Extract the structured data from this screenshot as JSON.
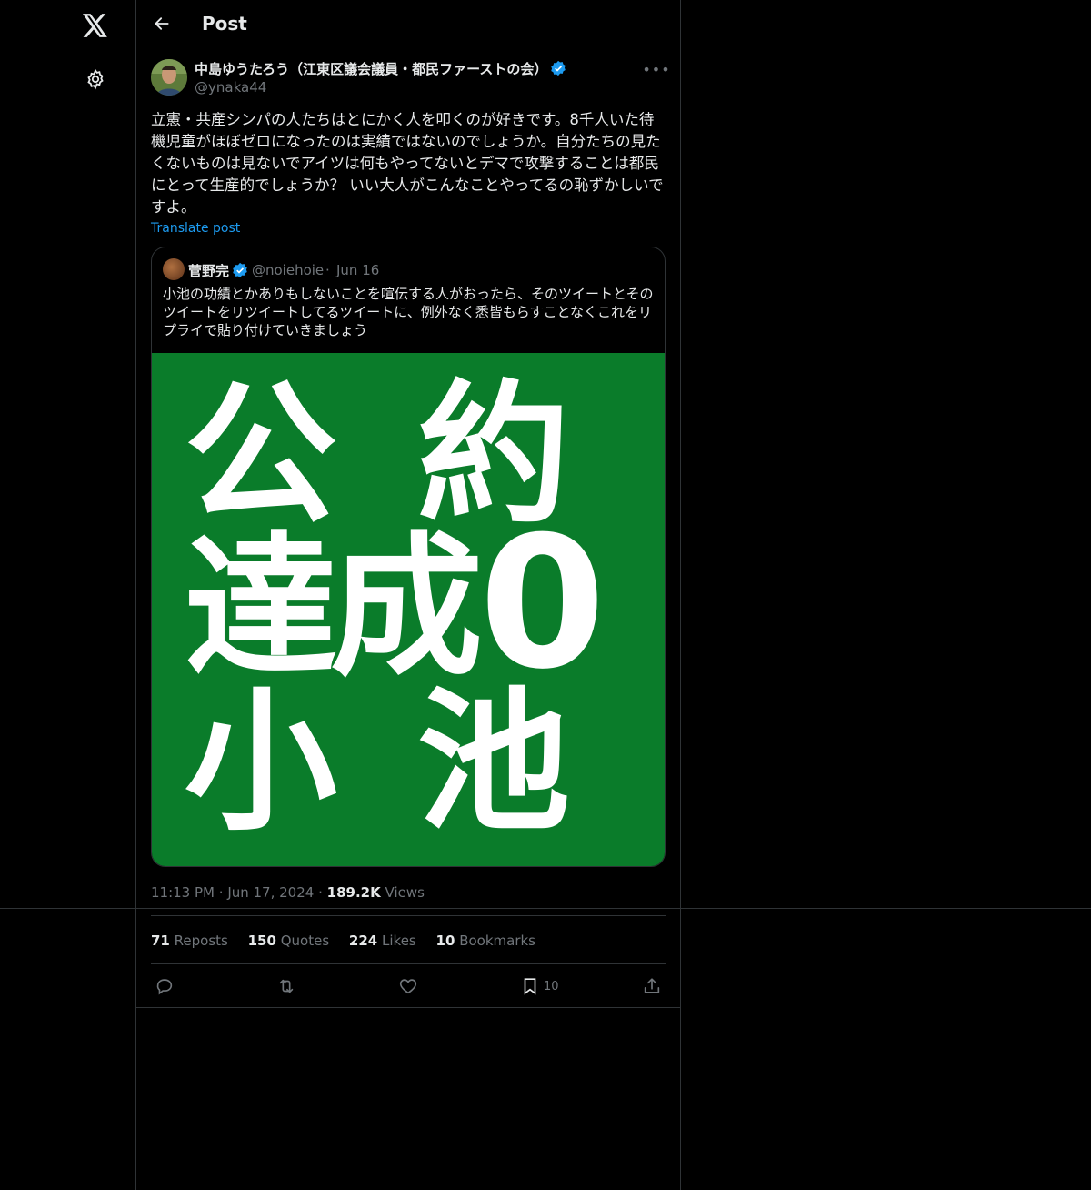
{
  "nav": {
    "logo": "x-logo-icon",
    "settings": "gear-icon"
  },
  "header": {
    "title": "Post"
  },
  "post": {
    "author_name": "中島ゆうたろう（江東区議会議員・都民ファーストの会）",
    "handle": "@ynaka44",
    "text": "立憲・共産シンパの人たちはとにかく人を叩くのが好きです。8千人いた待機児童がほぼゼロになったのは実績ではないのでしょうか。自分たちの見たくないものは見ないでアイツは何もやってないとデマで攻撃することは都民にとって生産的でしょうか？ いい大人がこんなことやってるの恥ずかしいですよ。",
    "translate": "Translate post",
    "time": "11:13 PM",
    "date": "Jun 17, 2024",
    "views_count": "189.2K",
    "views_label": "Views",
    "reposts": {
      "count": "71",
      "label": "Reposts"
    },
    "quotes": {
      "count": "150",
      "label": "Quotes"
    },
    "likes": {
      "count": "224",
      "label": "Likes"
    },
    "bookmarks": {
      "count": "10",
      "label": "Bookmarks"
    },
    "bookmark_action_count": "10"
  },
  "quote": {
    "name": "菅野完",
    "handle": "@noiehoie",
    "date": "Jun 16",
    "text": "小池の功績とかありもしないことを喧伝する人がおったら、そのツイートとそのツイートをリツイートしてるツイートに、例外なく悉皆もらすことなくこれをリプライで貼り付けていきましょう",
    "image": {
      "background": "#0a7c2a",
      "chars": [
        "公",
        "約",
        "達",
        "成",
        "0",
        "小",
        "池"
      ]
    }
  },
  "colors": {
    "accent": "#1d9bf0",
    "verified": "#1d9bf0",
    "muted": "#71767b",
    "border": "#2f3336"
  }
}
